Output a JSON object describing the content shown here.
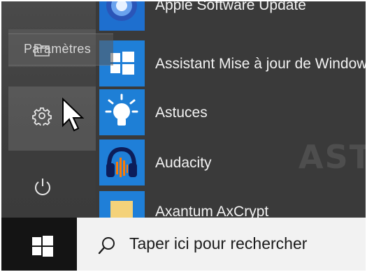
{
  "rail": {
    "tooltip_label": "Paramètres",
    "folder_icon": "folder-icon",
    "settings_icon": "gear-icon",
    "power_icon": "power-icon",
    "cursor_icon": "mouse-pointer-icon"
  },
  "apps": [
    {
      "label": "Apple Software Update",
      "icon": "apple-software-update-icon",
      "tile_color": "#1e6fcf"
    },
    {
      "label": "Assistant Mise à jour de Windows",
      "icon": "windows-logo-icon",
      "tile_color": "#1f7fd8"
    },
    {
      "label": "Astuces",
      "icon": "lightbulb-icon",
      "tile_color": "#1e7fd6"
    },
    {
      "label": "Audacity",
      "icon": "audacity-headphones-icon",
      "tile_color": "#1f7fd8"
    },
    {
      "label": "Axantum AxCrypt",
      "icon": "folder-icon",
      "tile_color": "#1f7fd8"
    }
  ],
  "watermark": "ASTUCES",
  "taskbar": {
    "start_icon": "windows-icon",
    "search_icon": "search-icon",
    "search_placeholder": "Taper ici pour rechercher",
    "colors": {
      "taskbar": "#141414",
      "search_bg": "#f2f2f2",
      "accent": "#1f7fd8"
    }
  }
}
